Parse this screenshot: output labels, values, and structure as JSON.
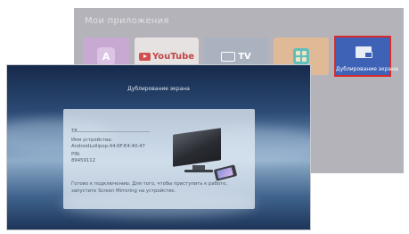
{
  "back_screen": {
    "section_title": "Мои приложения",
    "apps": [
      {
        "name": "A"
      },
      {
        "name": "YouTube"
      },
      {
        "name": "TV"
      },
      {
        "name": ""
      },
      {
        "name": "Дублирование экрана",
        "selected": true
      }
    ],
    "selected_border_color": "#d72b2b",
    "selected_tile_color": "#3e63b6"
  },
  "front_screen": {
    "title": "Дублирование экрана",
    "device_short": "T8",
    "device_name_label": "Имя устройства:",
    "device_name_value": "AndroidLollipop:44:6F:E4:40:47",
    "pin_label": "PIN:",
    "pin_value": "89459112",
    "status_text": "Готово к подключению. Для того, чтобы приступить к работе, запустите Screen Mirroring на устройстве."
  }
}
